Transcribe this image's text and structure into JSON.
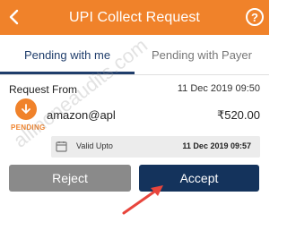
{
  "header": {
    "title": "UPI Collect Request",
    "back_icon": "chevron-left-icon",
    "help_label": "?",
    "help_icon": "help-circle-icon",
    "background_color": "#f0822a"
  },
  "tabs": [
    {
      "label": "Pending with me",
      "active": true
    },
    {
      "label": "Pending with Payer",
      "active": false
    }
  ],
  "request": {
    "label": "Request From",
    "date": "11 Dec 2019 09:50",
    "status": "PENDING",
    "status_icon": "arrow-down-circle-icon",
    "payer": "amazon@apl",
    "amount": "₹520.00",
    "valid_label": "Valid Upto",
    "valid_icon": "calendar-icon",
    "valid_date": "11 Dec 2019 09:57"
  },
  "actions": {
    "reject_label": "Reject",
    "accept_label": "Accept"
  },
  "watermark": "allinoneaudits.com",
  "colors": {
    "accent": "#f0822a",
    "primary": "#14335c",
    "reject": "#8a8a8a",
    "annotation_arrow": "#e8453c"
  }
}
